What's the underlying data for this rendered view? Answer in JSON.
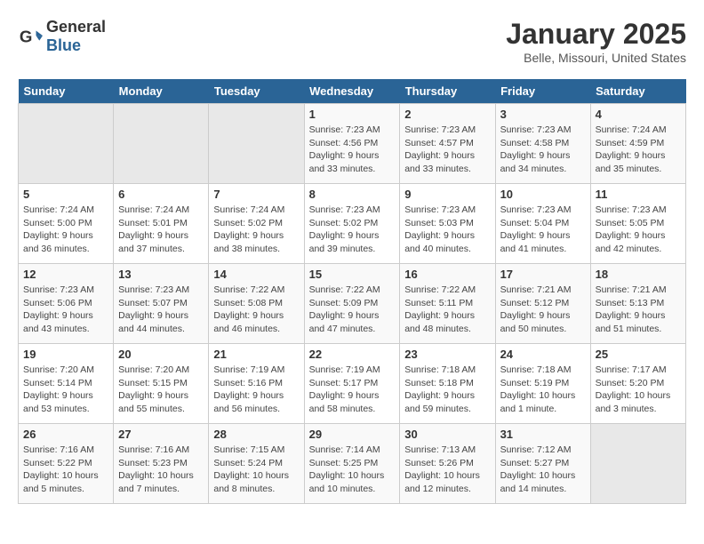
{
  "header": {
    "logo": {
      "general": "General",
      "blue": "Blue"
    },
    "title": "January 2025",
    "location": "Belle, Missouri, United States"
  },
  "weekdays": [
    "Sunday",
    "Monday",
    "Tuesday",
    "Wednesday",
    "Thursday",
    "Friday",
    "Saturday"
  ],
  "weeks": [
    [
      {
        "day": "",
        "empty": true
      },
      {
        "day": "",
        "empty": true
      },
      {
        "day": "",
        "empty": true
      },
      {
        "day": "1",
        "sunrise": "7:23 AM",
        "sunset": "4:56 PM",
        "daylight": "9 hours and 33 minutes."
      },
      {
        "day": "2",
        "sunrise": "7:23 AM",
        "sunset": "4:57 PM",
        "daylight": "9 hours and 33 minutes."
      },
      {
        "day": "3",
        "sunrise": "7:23 AM",
        "sunset": "4:58 PM",
        "daylight": "9 hours and 34 minutes."
      },
      {
        "day": "4",
        "sunrise": "7:24 AM",
        "sunset": "4:59 PM",
        "daylight": "9 hours and 35 minutes."
      }
    ],
    [
      {
        "day": "5",
        "sunrise": "7:24 AM",
        "sunset": "5:00 PM",
        "daylight": "9 hours and 36 minutes."
      },
      {
        "day": "6",
        "sunrise": "7:24 AM",
        "sunset": "5:01 PM",
        "daylight": "9 hours and 37 minutes."
      },
      {
        "day": "7",
        "sunrise": "7:24 AM",
        "sunset": "5:02 PM",
        "daylight": "9 hours and 38 minutes."
      },
      {
        "day": "8",
        "sunrise": "7:23 AM",
        "sunset": "5:02 PM",
        "daylight": "9 hours and 39 minutes."
      },
      {
        "day": "9",
        "sunrise": "7:23 AM",
        "sunset": "5:03 PM",
        "daylight": "9 hours and 40 minutes."
      },
      {
        "day": "10",
        "sunrise": "7:23 AM",
        "sunset": "5:04 PM",
        "daylight": "9 hours and 41 minutes."
      },
      {
        "day": "11",
        "sunrise": "7:23 AM",
        "sunset": "5:05 PM",
        "daylight": "9 hours and 42 minutes."
      }
    ],
    [
      {
        "day": "12",
        "sunrise": "7:23 AM",
        "sunset": "5:06 PM",
        "daylight": "9 hours and 43 minutes."
      },
      {
        "day": "13",
        "sunrise": "7:23 AM",
        "sunset": "5:07 PM",
        "daylight": "9 hours and 44 minutes."
      },
      {
        "day": "14",
        "sunrise": "7:22 AM",
        "sunset": "5:08 PM",
        "daylight": "9 hours and 46 minutes."
      },
      {
        "day": "15",
        "sunrise": "7:22 AM",
        "sunset": "5:09 PM",
        "daylight": "9 hours and 47 minutes."
      },
      {
        "day": "16",
        "sunrise": "7:22 AM",
        "sunset": "5:11 PM",
        "daylight": "9 hours and 48 minutes."
      },
      {
        "day": "17",
        "sunrise": "7:21 AM",
        "sunset": "5:12 PM",
        "daylight": "9 hours and 50 minutes."
      },
      {
        "day": "18",
        "sunrise": "7:21 AM",
        "sunset": "5:13 PM",
        "daylight": "9 hours and 51 minutes."
      }
    ],
    [
      {
        "day": "19",
        "sunrise": "7:20 AM",
        "sunset": "5:14 PM",
        "daylight": "9 hours and 53 minutes."
      },
      {
        "day": "20",
        "sunrise": "7:20 AM",
        "sunset": "5:15 PM",
        "daylight": "9 hours and 55 minutes."
      },
      {
        "day": "21",
        "sunrise": "7:19 AM",
        "sunset": "5:16 PM",
        "daylight": "9 hours and 56 minutes."
      },
      {
        "day": "22",
        "sunrise": "7:19 AM",
        "sunset": "5:17 PM",
        "daylight": "9 hours and 58 minutes."
      },
      {
        "day": "23",
        "sunrise": "7:18 AM",
        "sunset": "5:18 PM",
        "daylight": "9 hours and 59 minutes."
      },
      {
        "day": "24",
        "sunrise": "7:18 AM",
        "sunset": "5:19 PM",
        "daylight": "10 hours and 1 minute."
      },
      {
        "day": "25",
        "sunrise": "7:17 AM",
        "sunset": "5:20 PM",
        "daylight": "10 hours and 3 minutes."
      }
    ],
    [
      {
        "day": "26",
        "sunrise": "7:16 AM",
        "sunset": "5:22 PM",
        "daylight": "10 hours and 5 minutes."
      },
      {
        "day": "27",
        "sunrise": "7:16 AM",
        "sunset": "5:23 PM",
        "daylight": "10 hours and 7 minutes."
      },
      {
        "day": "28",
        "sunrise": "7:15 AM",
        "sunset": "5:24 PM",
        "daylight": "10 hours and 8 minutes."
      },
      {
        "day": "29",
        "sunrise": "7:14 AM",
        "sunset": "5:25 PM",
        "daylight": "10 hours and 10 minutes."
      },
      {
        "day": "30",
        "sunrise": "7:13 AM",
        "sunset": "5:26 PM",
        "daylight": "10 hours and 12 minutes."
      },
      {
        "day": "31",
        "sunrise": "7:12 AM",
        "sunset": "5:27 PM",
        "daylight": "10 hours and 14 minutes."
      },
      {
        "day": "",
        "empty": true
      }
    ]
  ]
}
